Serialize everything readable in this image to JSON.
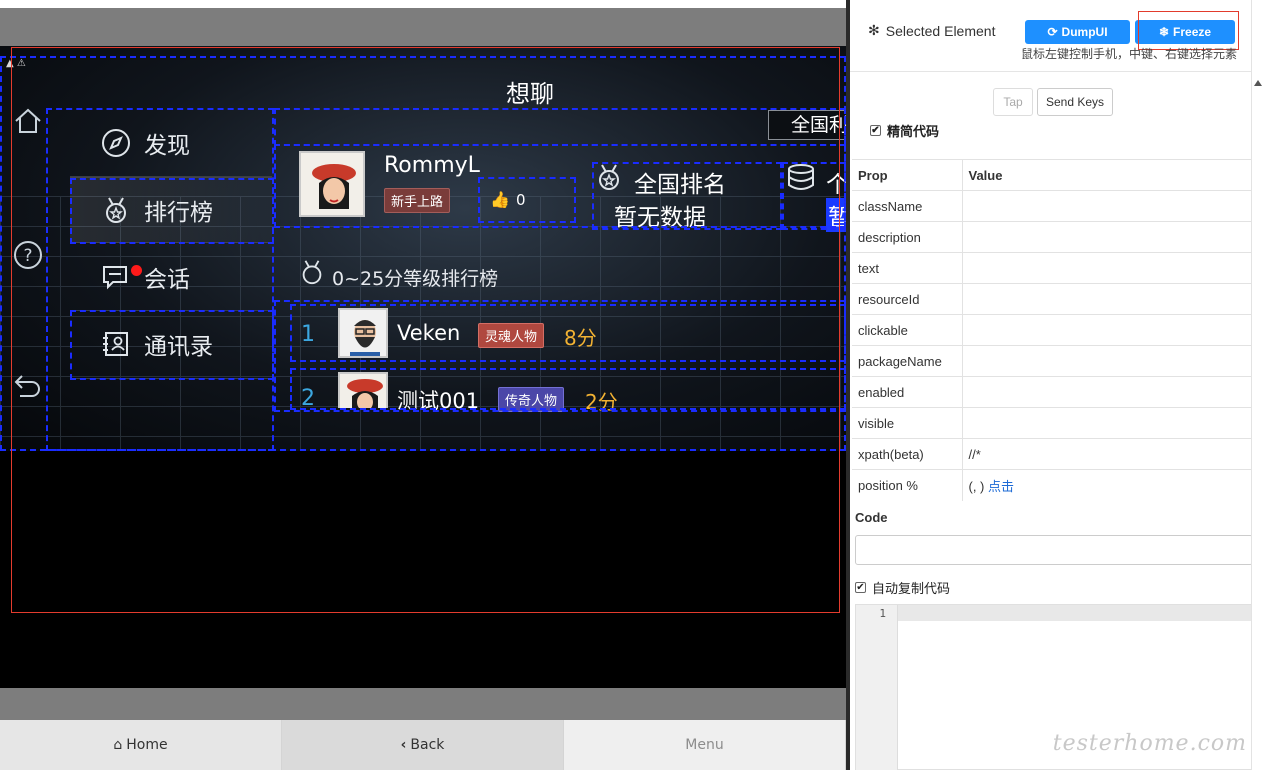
{
  "device": {
    "warning_icon": "warning-triangle-icon",
    "app_title": "想聊",
    "rail": {
      "home_icon": "home-icon",
      "help_icon": "help-circle-icon",
      "back_icon": "back-arrow-icon"
    },
    "nav": [
      {
        "label": "发现",
        "icon": "compass-icon"
      },
      {
        "label": "排行榜",
        "icon": "medal-icon"
      },
      {
        "label": "会话",
        "icon": "chat-icon"
      },
      {
        "label": "通讯录",
        "icon": "contacts-icon"
      }
    ],
    "top_tab": "全国利",
    "profile": {
      "name": "RommyL",
      "level_badge": "新手上路",
      "likes": "0"
    },
    "stats": [
      {
        "title": "全国排名",
        "value": "暂无数据",
        "icon": "medal-icon"
      },
      {
        "title": "个",
        "value": "暂",
        "icon": "database-icon"
      }
    ],
    "leaderboard": {
      "title": "0~25分等级排行榜",
      "rows": [
        {
          "rank": "1",
          "name": "Veken",
          "badge": "灵魂人物",
          "score": "8分",
          "badge_color": "#b0483f"
        },
        {
          "rank": "2",
          "name": "测试001",
          "badge": "传奇人物",
          "score": "2分",
          "badge_color": "#4b47a8"
        }
      ]
    }
  },
  "navbar": {
    "home": "Home",
    "back": "Back",
    "menu": "Menu"
  },
  "inspector": {
    "selected_title": "Selected Element",
    "dump_button": "DumpUI",
    "freeze_button": "Freeze",
    "hint": "鼠标左键控制手机，中键、右键选择元素",
    "tap_button": "Tap",
    "send_keys_button": "Send Keys",
    "simplify_code_label": "精简代码",
    "table_headers": {
      "prop": "Prop",
      "value": "Value"
    },
    "props": [
      {
        "key": "className",
        "value": ""
      },
      {
        "key": "description",
        "value": ""
      },
      {
        "key": "text",
        "value": ""
      },
      {
        "key": "resourceId",
        "value": ""
      },
      {
        "key": "clickable",
        "value": ""
      },
      {
        "key": "packageName",
        "value": ""
      },
      {
        "key": "enabled",
        "value": ""
      },
      {
        "key": "visible",
        "value": ""
      },
      {
        "key": "xpath(beta)",
        "value": "//*"
      },
      {
        "key": "position %",
        "value": "(, )",
        "link": "点击"
      }
    ],
    "code_label": "Code",
    "auto_copy_label": "自动复制代码",
    "editor_line": "1",
    "watermark": "testerhome.com"
  }
}
